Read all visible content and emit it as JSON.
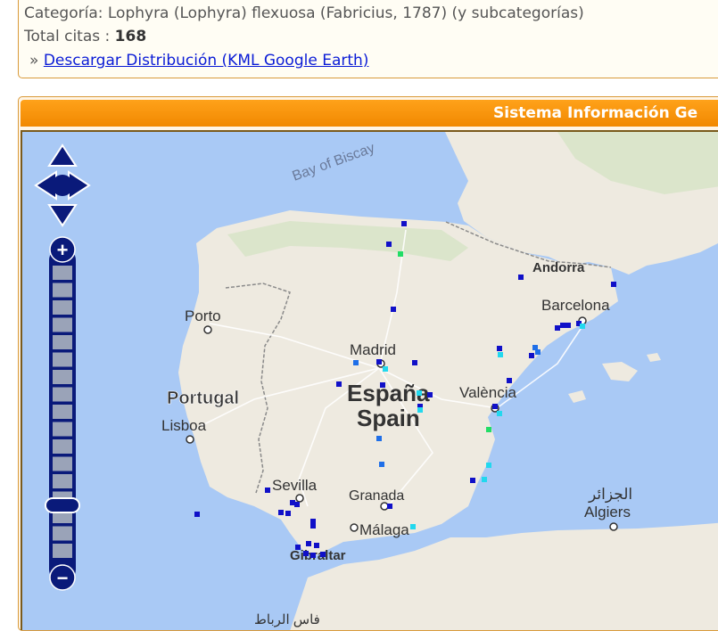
{
  "info": {
    "category_text": "Categoría: Lophyra (Lophyra) flexuosa (Fabricius, 1787) (y subcategorías)",
    "total_label": "Total citas : ",
    "total_value": "168",
    "download_prefix": "»",
    "download_link": "Descargar Distribución (KML Google Earth)"
  },
  "panel": {
    "title": "Sistema Información Ge"
  },
  "map": {
    "labels": {
      "bay": "Bay of Biscay",
      "porto": "Porto",
      "portugal": "Portugal",
      "lisboa": "Lisboa",
      "madrid": "Madrid",
      "espana": "España",
      "spain": "Spain",
      "valencia": "València",
      "andorra": "Andorra",
      "barcelona": "Barcelona",
      "sevilla": "Sevilla",
      "granada": "Granada",
      "malaga": "Málaga",
      "gibraltar": "Gibraltar",
      "algiers_ar": "الجزائر",
      "algiers": "Algiers",
      "bottom_ar": "فاس   الرباط"
    },
    "controls": {
      "zoom_in": "+",
      "zoom_out": "−"
    },
    "colors": {
      "sea": "#a9c9f5",
      "land": "#eeeae0",
      "record_dark": "#1010c8",
      "record_mid": "#1f6fe8",
      "record_light": "#22d8ee",
      "record_green": "#22dd66",
      "control": "#0a1a7a"
    }
  }
}
